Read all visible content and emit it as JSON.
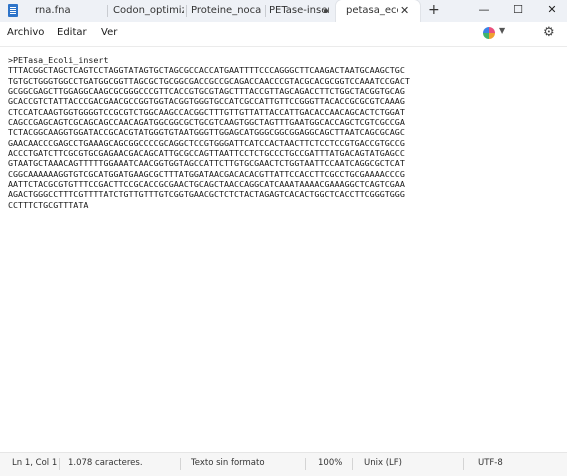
{
  "tabs": [
    {
      "label": "rna.fna"
    },
    {
      "label": "Codon_optimizatio"
    },
    {
      "label": "Proteine_nocabeza"
    },
    {
      "label": "PETase-insert"
    },
    {
      "label": "petasa_ecol",
      "active": true
    }
  ],
  "window": {
    "minimize": "—",
    "maximize": "☐",
    "close": "✕"
  },
  "menu": {
    "file": "Archivo",
    "edit": "Editar",
    "view": "Ver"
  },
  "document": {
    "content": ">PETasa_Ecoli_insert\nTTTACGGCTAGCTCAGTCCTAGGTATAGTGCTAGCGCCACCATGAATTTTCCCAGGGCTTCAAGACTAATGCAAGCTGC\nTGTGCTGGGTGGCCTGATGGCGGTTAGCGCTGCGGCGACCGCCGCAGACCAACCCGTACGCACGCGGTCCAAATCCGACT\nGCGGCGAGCTTGGAGGCAAGCGCGGGCCCGTTCACCGTGCGTAGCTTTACCGTTAGCAGACCTTCTGGCTACGGTGCAG\nGCACCGTCTATTACCCGACGAACGCCGGTGGTACGGTGGGTGCCATCGCCATTGTTCCGGGTTACACCGCGCGTCAAAG\nCTCCATCAAGTGGTGGGGTCCGCGTCTGGCAAGCCACGGCTTTGTTGTTATTACCATTGACACCAACAGCACTCTGGAT\nCAGCCGAGCAGTCGCAGCAGCCAACAGATGGCGGCGCTGCGTCAAGTGGCTAGTTTGAATGGCACCAGCTCGTCGCCGA\nTCTACGGCAAGGTGGATACCGCACGTATGGGTGTAATGGGTTGGAGCATGGGCGGCGGAGGCAGCTTAATCAGCGCAGC\nGAACAACCCGAGCCTGAAAGCAGCGGCCCCGCAGGCTCCGTGGGATTCATCCACTAACTTCTCCTCCGTGACCGTGCCG\nACCCTGATCTTCGCGTGCGAGAACGACAGCATTGCGCCAGTTAATTCCTCTGCCCTGCCGATTTATGACAGTATGAGCC\nGTAATGCTAAACAGTTTTTGGAAATCAACGGTGGTAGCCATTCTTGTGCGAACTCTGGTAATTCCAATCAGGCGCTCAT\nCGGCAAAAAAGGTGTCGCATGGATGAAGCGCTTTATGGATAACGACACACGTTATTCCACCTTCGCCTGCGAAAACCCG\nAATTCTACGCGTGTTTCCGACTTCCGCACCGCGAACTGCAGCTAACCAGGCATCAAATAAAACGAAAGGCTCAGTCGAA\nAGACTGGGCCTTTCGTTTTATCTGTTGTTTGTCGGTGAACGCTCTCTACTAGAGTCACACTGGCTCACCTTCGGGTGGG\nCCTTTCTGCGTTTATA"
  },
  "status": {
    "position": "Ln 1, Col 1",
    "chars": "1.078 caracteres.",
    "format": "Texto sin formato",
    "zoom": "100%",
    "line_ending": "Unix (LF)",
    "encoding": "UTF-8"
  }
}
